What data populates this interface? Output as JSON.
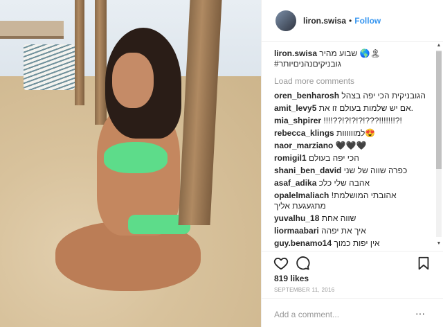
{
  "post": {
    "username": "liron.swisa",
    "follow_label": "Follow",
    "separator": "•"
  },
  "caption": {
    "username": "liron.swisa",
    "text": "שבוע מהיר 🌎🏝\n#גובניקיםנהניםיותר"
  },
  "comments": {
    "load_more": "Load more comments",
    "items": [
      {
        "user": "oren_benharosh",
        "text": "הגובניקית הכי יפה בצהל"
      },
      {
        "user": "amit_levy5",
        "text": "אם יש שלמות בעולם זו את."
      },
      {
        "user": "mia_shpirer",
        "text": "!!!!??!?!?!?!???!!!!!!!?!"
      },
      {
        "user": "rebecca_klings",
        "text": "למוווווות😍"
      },
      {
        "user": "naor_marziano",
        "text": "🖤🖤🖤"
      },
      {
        "user": "romigil1",
        "text": "הכי יפה בעולם"
      },
      {
        "user": "shani_ben_david",
        "text": "כפרה שווה של שני"
      },
      {
        "user": "asaf_adika",
        "text": "אהבה שלי כלכ"
      },
      {
        "user": "opalelmaliach",
        "text": "אהובתי המושלמת! מתגעגעת אליך"
      },
      {
        "user": "yuvalhu_18",
        "text": "שווה אחת"
      },
      {
        "user": "liormaabari",
        "text": "איך את יפהה"
      },
      {
        "user": "guy.benamo14",
        "text": "אין יפות כמוך"
      }
    ]
  },
  "actions": {
    "like_icon": "heart-icon",
    "comment_icon": "comment-icon",
    "save_icon": "bookmark-icon"
  },
  "likes": "819 likes",
  "date": "SEPTEMBER 11, 2016",
  "add_comment": {
    "placeholder": "Add a comment..."
  },
  "more_label": "···",
  "colors": {
    "follow": "#3897f0",
    "bikini": "#5ddc8a",
    "muted": "#999999"
  }
}
